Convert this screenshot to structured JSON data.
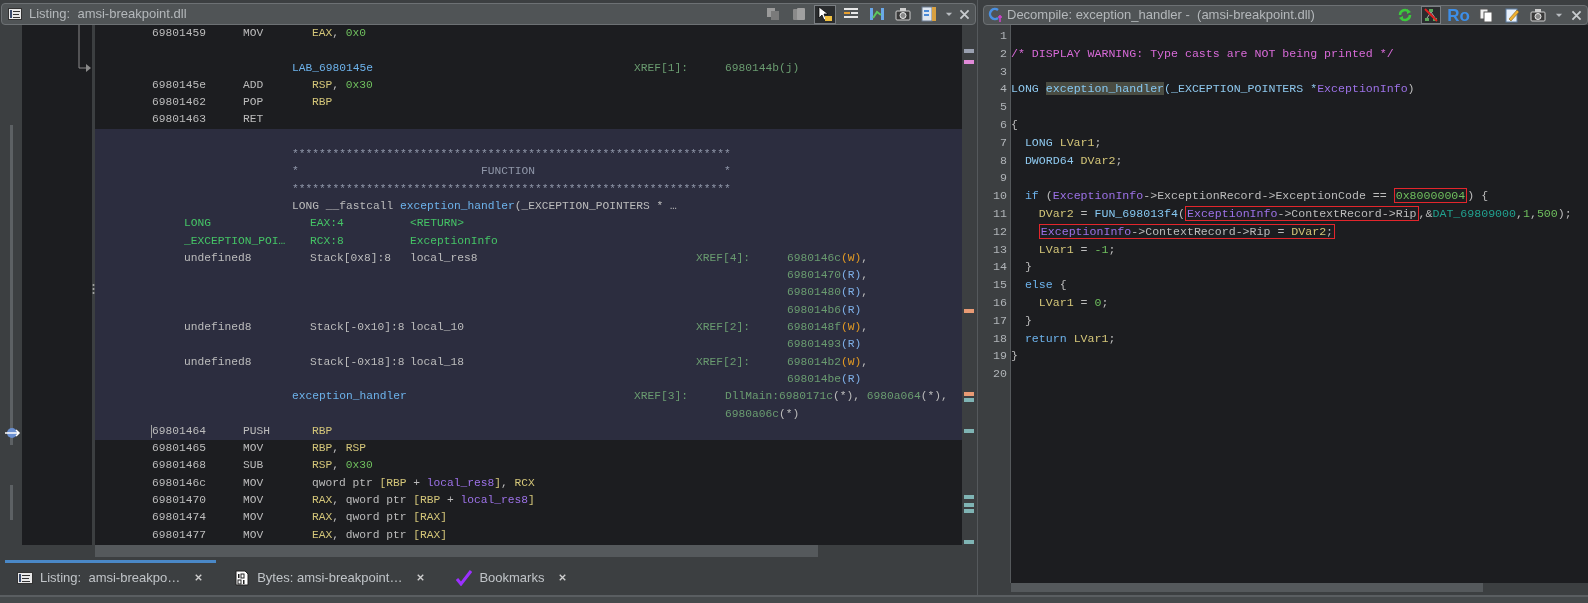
{
  "listing": {
    "title": "Listing:  amsi-breakpoint.dll",
    "toolbar": [
      {
        "pressed": false
      },
      {
        "pressed": false
      },
      {
        "pressed": true
      },
      {
        "pressed": false
      },
      {
        "pressed": false
      },
      {
        "pressed": false
      },
      {
        "pressed": false
      }
    ],
    "rows": [
      {
        "highlighted": false,
        "cells": [
          {
            "kind": "address",
            "segments": [
              {
                "text": "69801459",
                "kind": "plain"
              }
            ]
          },
          {
            "kind": "mnemonic",
            "segments": [
              {
                "text": "MOV",
                "kind": "plain"
              }
            ]
          },
          {
            "kind": "operand",
            "segments": [
              {
                "text": "EAX",
                "kind": "register"
              },
              {
                "text": ", ",
                "kind": "plain"
              },
              {
                "text": "0x0",
                "kind": "number"
              }
            ]
          }
        ]
      },
      {
        "highlighted": false
      },
      {
        "highlighted": false,
        "cells": [
          {
            "kind": "label",
            "segments": [
              {
                "text": "LAB_6980145e",
                "kind": "label"
              }
            ]
          },
          {
            "kind": "function_xref_label",
            "segments": [
              {
                "text": "XREF[1]:",
                "kind": "xref"
              }
            ]
          },
          {
            "kind": "function_xrefs",
            "segments": [
              {
                "text": "6980144b(j)",
                "kind": "xref"
              }
            ]
          }
        ]
      },
      {
        "highlighted": false,
        "cells": [
          {
            "kind": "address",
            "segments": [
              {
                "text": "6980145e",
                "kind": "plain"
              }
            ]
          },
          {
            "kind": "mnemonic",
            "segments": [
              {
                "text": "ADD",
                "kind": "plain"
              }
            ]
          },
          {
            "kind": "operand",
            "segments": [
              {
                "text": "RSP",
                "kind": "register"
              },
              {
                "text": ", ",
                "kind": "plain"
              },
              {
                "text": "0x30",
                "kind": "number"
              }
            ]
          }
        ]
      },
      {
        "highlighted": false,
        "cells": [
          {
            "kind": "address",
            "segments": [
              {
                "text": "69801462",
                "kind": "plain"
              }
            ]
          },
          {
            "kind": "mnemonic",
            "segments": [
              {
                "text": "POP",
                "kind": "plain"
              }
            ]
          },
          {
            "kind": "operand",
            "segments": [
              {
                "text": "RBP",
                "kind": "register"
              }
            ]
          }
        ]
      },
      {
        "highlighted": false,
        "cells": [
          {
            "kind": "address",
            "segments": [
              {
                "text": "69801463",
                "kind": "plain"
              }
            ]
          },
          {
            "kind": "mnemonic",
            "segments": [
              {
                "text": "RET",
                "kind": "plain"
              }
            ]
          }
        ]
      },
      {
        "highlighted": true
      },
      {
        "highlighted": true,
        "cells": [
          {
            "kind": "label",
            "segments": [
              {
                "text": "*****************************************************************",
                "kind": "banner"
              }
            ]
          }
        ]
      },
      {
        "highlighted": true,
        "cells": [
          {
            "kind": "label",
            "segments": [
              {
                "text": "*                           FUNCTION                            *",
                "kind": "banner"
              }
            ]
          }
        ]
      },
      {
        "highlighted": true,
        "cells": [
          {
            "kind": "label",
            "segments": [
              {
                "text": "*****************************************************************",
                "kind": "banner"
              }
            ]
          }
        ]
      },
      {
        "highlighted": true,
        "cells": [
          {
            "kind": "label",
            "segments": [
              {
                "text": "LONG __fastcall ",
                "kind": "plain"
              },
              {
                "text": "exception_handler",
                "kind": "label"
              },
              {
                "text": "(_EXCEPTION_POINTERS * …",
                "kind": "plain"
              }
            ]
          }
        ]
      },
      {
        "highlighted": true,
        "cells": [
          {
            "kind": "param_type",
            "segments": [
              {
                "text": "LONG",
                "kind": "parameter"
              }
            ]
          },
          {
            "kind": "param_storage",
            "segments": [
              {
                "text": "EAX:4",
                "kind": "parameter"
              }
            ]
          },
          {
            "kind": "param_name",
            "segments": [
              {
                "text": "<RETURN>",
                "kind": "parameter"
              }
            ]
          }
        ]
      },
      {
        "highlighted": true,
        "cells": [
          {
            "kind": "param_type",
            "segments": [
              {
                "text": "_EXCEPTION_POI…",
                "kind": "parameter"
              }
            ]
          },
          {
            "kind": "param_storage",
            "segments": [
              {
                "text": "RCX:8",
                "kind": "parameter"
              }
            ]
          },
          {
            "kind": "param_name",
            "segments": [
              {
                "text": "ExceptionInfo",
                "kind": "parameter"
              }
            ]
          }
        ]
      },
      {
        "highlighted": true,
        "cells": [
          {
            "kind": "param_type",
            "segments": [
              {
                "text": "undefined8",
                "kind": "plain"
              }
            ]
          },
          {
            "kind": "param_storage",
            "segments": [
              {
                "text": "Stack[0x8]:8",
                "kind": "plain"
              }
            ]
          },
          {
            "kind": "param_name",
            "segments": [
              {
                "text": "local_res8",
                "kind": "plain"
              }
            ]
          },
          {
            "kind": "local_xref_label",
            "segments": [
              {
                "text": "XREF[4]:",
                "kind": "xref"
              }
            ]
          },
          {
            "kind": "local_xrefs",
            "segments": [
              {
                "text": "6980146c",
                "kind": "xref"
              },
              {
                "text": "(W)",
                "kind": "write"
              },
              {
                "text": ",",
                "kind": "plain"
              }
            ]
          }
        ]
      },
      {
        "highlighted": true,
        "cells": [
          {
            "kind": "local_xrefs",
            "segments": [
              {
                "text": "69801470",
                "kind": "xref"
              },
              {
                "text": "(R)",
                "kind": "read"
              },
              {
                "text": ",",
                "kind": "plain"
              }
            ]
          }
        ]
      },
      {
        "highlighted": true,
        "cells": [
          {
            "kind": "local_xrefs",
            "segments": [
              {
                "text": "69801480",
                "kind": "xref"
              },
              {
                "text": "(R)",
                "kind": "read"
              },
              {
                "text": ",",
                "kind": "plain"
              }
            ]
          }
        ]
      },
      {
        "highlighted": true,
        "cells": [
          {
            "kind": "local_xrefs",
            "segments": [
              {
                "text": "698014b6",
                "kind": "xref"
              },
              {
                "text": "(R)",
                "kind": "read"
              }
            ]
          }
        ]
      },
      {
        "highlighted": true,
        "cells": [
          {
            "kind": "param_type",
            "segments": [
              {
                "text": "undefined8",
                "kind": "plain"
              }
            ]
          },
          {
            "kind": "param_storage",
            "segments": [
              {
                "text": "Stack[-0x10]:8",
                "kind": "plain"
              }
            ]
          },
          {
            "kind": "param_name",
            "segments": [
              {
                "text": "local_10",
                "kind": "plain"
              }
            ]
          },
          {
            "kind": "local_xref_label",
            "segments": [
              {
                "text": "XREF[2]:",
                "kind": "xref"
              }
            ]
          },
          {
            "kind": "local_xrefs",
            "segments": [
              {
                "text": "6980148f",
                "kind": "xref"
              },
              {
                "text": "(W)",
                "kind": "write"
              },
              {
                "text": ",",
                "kind": "plain"
              }
            ]
          }
        ]
      },
      {
        "highlighted": true,
        "cells": [
          {
            "kind": "local_xrefs",
            "segments": [
              {
                "text": "69801493",
                "kind": "xref"
              },
              {
                "text": "(R)",
                "kind": "read"
              }
            ]
          }
        ]
      },
      {
        "highlighted": true,
        "cells": [
          {
            "kind": "param_type",
            "segments": [
              {
                "text": "undefined8",
                "kind": "plain"
              }
            ]
          },
          {
            "kind": "param_storage",
            "segments": [
              {
                "text": "Stack[-0x18]:8",
                "kind": "plain"
              }
            ]
          },
          {
            "kind": "param_name",
            "segments": [
              {
                "text": "local_18",
                "kind": "plain"
              }
            ]
          },
          {
            "kind": "local_xref_label",
            "segments": [
              {
                "text": "XREF[2]:",
                "kind": "xref"
              }
            ]
          },
          {
            "kind": "local_xrefs",
            "segments": [
              {
                "text": "698014b2",
                "kind": "xref"
              },
              {
                "text": "(W)",
                "kind": "write"
              },
              {
                "text": ",",
                "kind": "plain"
              }
            ]
          }
        ]
      },
      {
        "highlighted": true,
        "cells": [
          {
            "kind": "local_xrefs",
            "segments": [
              {
                "text": "698014be",
                "kind": "xref"
              },
              {
                "text": "(R)",
                "kind": "read"
              }
            ]
          }
        ]
      },
      {
        "highlighted": true,
        "cells": [
          {
            "kind": "label",
            "segments": [
              {
                "text": "exception_handler",
                "kind": "label"
              }
            ]
          },
          {
            "kind": "function_xref_label",
            "segments": [
              {
                "text": "XREF[3]:",
                "kind": "xref"
              }
            ]
          },
          {
            "kind": "function_xrefs",
            "segments": [
              {
                "text": "DllMain:6980171c",
                "kind": "xref"
              },
              {
                "text": "(*), ",
                "kind": "plain"
              },
              {
                "text": "6980a064",
                "kind": "xref"
              },
              {
                "text": "(*),",
                "kind": "plain"
              }
            ]
          }
        ]
      },
      {
        "highlighted": true,
        "cells": [
          {
            "kind": "function_xrefs",
            "segments": [
              {
                "text": "6980a06c",
                "kind": "xref"
              },
              {
                "text": "(*)",
                "kind": "plain"
              }
            ]
          }
        ]
      },
      {
        "highlighted": true,
        "cursor": true,
        "cells": [
          {
            "kind": "address",
            "segments": [
              {
                "text": "69801464",
                "kind": "plain"
              }
            ]
          },
          {
            "kind": "mnemonic",
            "segments": [
              {
                "text": "PUSH",
                "kind": "plain"
              }
            ]
          },
          {
            "kind": "operand",
            "segments": [
              {
                "text": "RBP",
                "kind": "register"
              }
            ]
          }
        ]
      },
      {
        "highlighted": false,
        "cells": [
          {
            "kind": "address",
            "segments": [
              {
                "text": "69801465",
                "kind": "plain"
              }
            ]
          },
          {
            "kind": "mnemonic",
            "segments": [
              {
                "text": "MOV",
                "kind": "plain"
              }
            ]
          },
          {
            "kind": "operand",
            "segments": [
              {
                "text": "RBP",
                "kind": "register"
              },
              {
                "text": ", ",
                "kind": "plain"
              },
              {
                "text": "RSP",
                "kind": "register"
              }
            ]
          }
        ]
      },
      {
        "highlighted": false,
        "cells": [
          {
            "kind": "address",
            "segments": [
              {
                "text": "69801468",
                "kind": "plain"
              }
            ]
          },
          {
            "kind": "mnemonic",
            "segments": [
              {
                "text": "SUB",
                "kind": "plain"
              }
            ]
          },
          {
            "kind": "operand",
            "segments": [
              {
                "text": "RSP",
                "kind": "register"
              },
              {
                "text": ", ",
                "kind": "plain"
              },
              {
                "text": "0x30",
                "kind": "number"
              }
            ]
          }
        ]
      },
      {
        "highlighted": false,
        "cells": [
          {
            "kind": "address",
            "segments": [
              {
                "text": "6980146c",
                "kind": "plain"
              }
            ]
          },
          {
            "kind": "mnemonic",
            "segments": [
              {
                "text": "MOV",
                "kind": "plain"
              }
            ]
          },
          {
            "kind": "operand",
            "segments": [
              {
                "text": "qword ptr ",
                "kind": "plain"
              },
              {
                "text": "[RBP",
                "kind": "register"
              },
              {
                "text": " + ",
                "kind": "plain"
              },
              {
                "text": "local_res8",
                "kind": "variable"
              },
              {
                "text": "]",
                "kind": "register"
              },
              {
                "text": ", ",
                "kind": "plain"
              },
              {
                "text": "RCX",
                "kind": "register"
              }
            ]
          }
        ]
      },
      {
        "highlighted": false,
        "cells": [
          {
            "kind": "address",
            "segments": [
              {
                "text": "69801470",
                "kind": "plain"
              }
            ]
          },
          {
            "kind": "mnemonic",
            "segments": [
              {
                "text": "MOV",
                "kind": "plain"
              }
            ]
          },
          {
            "kind": "operand",
            "segments": [
              {
                "text": "RAX",
                "kind": "register"
              },
              {
                "text": ", qword ptr ",
                "kind": "plain"
              },
              {
                "text": "[RBP",
                "kind": "register"
              },
              {
                "text": " + ",
                "kind": "plain"
              },
              {
                "text": "local_res8",
                "kind": "variable"
              },
              {
                "text": "]",
                "kind": "register"
              }
            ]
          }
        ]
      },
      {
        "highlighted": false,
        "cells": [
          {
            "kind": "address",
            "segments": [
              {
                "text": "69801474",
                "kind": "plain"
              }
            ]
          },
          {
            "kind": "mnemonic",
            "segments": [
              {
                "text": "MOV",
                "kind": "plain"
              }
            ]
          },
          {
            "kind": "operand",
            "segments": [
              {
                "text": "RAX",
                "kind": "register"
              },
              {
                "text": ", qword ptr ",
                "kind": "plain"
              },
              {
                "text": "[RAX]",
                "kind": "register"
              }
            ]
          }
        ]
      },
      {
        "highlighted": false,
        "cells": [
          {
            "kind": "address",
            "segments": [
              {
                "text": "69801477",
                "kind": "plain"
              }
            ]
          },
          {
            "kind": "mnemonic",
            "segments": [
              {
                "text": "MOV",
                "kind": "plain"
              }
            ]
          },
          {
            "kind": "operand",
            "segments": [
              {
                "text": "EAX",
                "kind": "register"
              },
              {
                "text": ", dword ptr ",
                "kind": "plain"
              },
              {
                "text": "[RAX]",
                "kind": "register"
              }
            ]
          }
        ]
      }
    ]
  },
  "bottom_tabs": [
    {
      "label": "Listing:  amsi-breakpo…",
      "selected": true
    },
    {
      "label": "Bytes: amsi-breakpoint…",
      "selected": false
    },
    {
      "label": "Bookmarks",
      "selected": false
    }
  ],
  "decompile": {
    "title": "Decompile: exception_handler -  (amsi-breakpoint.dll)",
    "toolbar": [
      {
        "kind": "icon",
        "pressed": false
      },
      {
        "kind": "icon",
        "pressed": true
      },
      {
        "kind": "text",
        "label": "Ro",
        "pressed": false
      },
      {
        "kind": "icon",
        "pressed": false
      },
      {
        "kind": "icon",
        "pressed": false
      },
      {
        "kind": "icon",
        "pressed": false
      }
    ],
    "lines": [
      {
        "number": "1"
      },
      {
        "number": "2",
        "segments": [
          {
            "text": "/* DISPLAY WARNING: Type casts are NOT being printed */",
            "kind": "comment"
          }
        ]
      },
      {
        "number": "3"
      },
      {
        "number": "4",
        "segments": [
          {
            "text": "LONG ",
            "kind": "type"
          },
          {
            "text": "exception_handler",
            "kind": "function",
            "highlighted": true
          },
          {
            "text": "(_EXCEPTION_POINTERS *",
            "kind": "type"
          },
          {
            "text": "ExceptionInfo",
            "kind": "variable"
          },
          {
            "text": ")",
            "kind": "plain"
          }
        ]
      },
      {
        "number": "5"
      },
      {
        "number": "6",
        "segments": [
          {
            "text": "{",
            "kind": "plain"
          }
        ]
      },
      {
        "number": "7",
        "segments": [
          {
            "text": "  LONG ",
            "kind": "type"
          },
          {
            "text": "LVar1",
            "kind": "register"
          },
          {
            "text": ";",
            "kind": "plain"
          }
        ]
      },
      {
        "number": "8",
        "segments": [
          {
            "text": "  DWORD64 ",
            "kind": "type"
          },
          {
            "text": "DVar2",
            "kind": "register"
          },
          {
            "text": ";",
            "kind": "plain"
          }
        ]
      },
      {
        "number": "9"
      },
      {
        "number": "10",
        "segments": [
          {
            "text": "  if",
            "kind": "keyword"
          },
          {
            "text": " (",
            "kind": "plain"
          },
          {
            "text": "ExceptionInfo",
            "kind": "variable"
          },
          {
            "text": "->ExceptionRecord->ExceptionCode == ",
            "kind": "plain"
          },
          {
            "kind": "box",
            "boxed": true,
            "segments": [
              {
                "text": "0x80000004",
                "kind": "number"
              }
            ]
          },
          {
            "text": ") {",
            "kind": "plain"
          }
        ]
      },
      {
        "number": "11",
        "segments": [
          {
            "text": "    DVar2",
            "kind": "register"
          },
          {
            "text": " = ",
            "kind": "plain"
          },
          {
            "text": "FUN_698013f4",
            "kind": "function"
          },
          {
            "text": "(",
            "kind": "plain"
          },
          {
            "kind": "box",
            "boxed": true,
            "segments": [
              {
                "text": "ExceptionInfo",
                "kind": "variable"
              },
              {
                "text": "->ContextRecord->Rip",
                "kind": "plain"
              }
            ]
          },
          {
            "text": ",&",
            "kind": "plain"
          },
          {
            "text": "DAT_69809000",
            "kind": "global"
          },
          {
            "text": ",",
            "kind": "plain"
          },
          {
            "text": "1",
            "kind": "number"
          },
          {
            "text": ",",
            "kind": "plain"
          },
          {
            "text": "500",
            "kind": "number"
          },
          {
            "text": ");",
            "kind": "plain"
          }
        ]
      },
      {
        "number": "12",
        "segments": [
          {
            "kind": "box",
            "boxed": true,
            "segments": [
              {
                "text": "ExceptionInfo",
                "kind": "variable"
              },
              {
                "text": "->ContextRecord->Rip = ",
                "kind": "plain"
              },
              {
                "text": "DVar2",
                "kind": "register"
              },
              {
                "text": ";",
                "kind": "plain"
              }
            ]
          }
        ]
      },
      {
        "number": "13",
        "segments": [
          {
            "text": "    LVar1",
            "kind": "register"
          },
          {
            "text": " = ",
            "kind": "plain"
          },
          {
            "text": "-1",
            "kind": "number"
          },
          {
            "text": ";",
            "kind": "plain"
          }
        ]
      },
      {
        "number": "14",
        "segments": [
          {
            "text": "  }",
            "kind": "plain"
          }
        ]
      },
      {
        "number": "15",
        "segments": [
          {
            "text": "  else",
            "kind": "keyword"
          },
          {
            "text": " {",
            "kind": "plain"
          }
        ]
      },
      {
        "number": "16",
        "segments": [
          {
            "text": "    LVar1",
            "kind": "register"
          },
          {
            "text": " = ",
            "kind": "plain"
          },
          {
            "text": "0",
            "kind": "number"
          },
          {
            "text": ";",
            "kind": "plain"
          }
        ]
      },
      {
        "number": "17",
        "segments": [
          {
            "text": "  }",
            "kind": "plain"
          }
        ]
      },
      {
        "number": "18",
        "segments": [
          {
            "text": "  return ",
            "kind": "keyword"
          },
          {
            "text": "LVar1",
            "kind": "register"
          },
          {
            "text": ";",
            "kind": "plain"
          }
        ]
      },
      {
        "number": "19",
        "segments": [
          {
            "text": "}",
            "kind": "plain"
          }
        ]
      },
      {
        "number": "20"
      }
    ]
  }
}
